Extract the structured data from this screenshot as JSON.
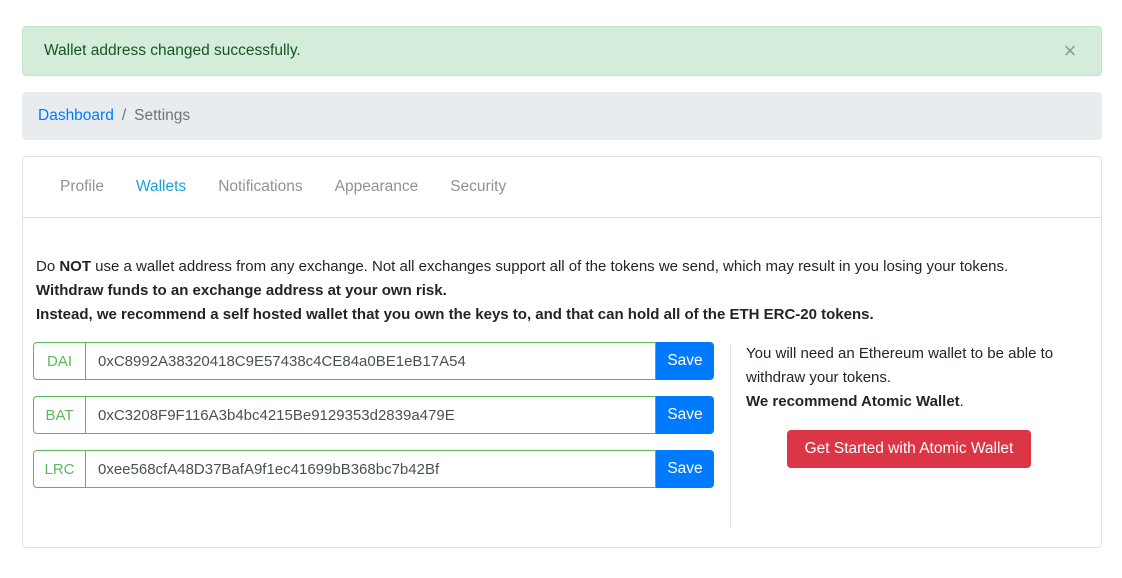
{
  "alert": {
    "message": "Wallet address changed successfully.",
    "close_symbol": "×"
  },
  "breadcrumb": {
    "home": "Dashboard",
    "separator": "/",
    "current": "Settings"
  },
  "tabs": [
    {
      "label": "Profile",
      "active": false
    },
    {
      "label": "Wallets",
      "active": true
    },
    {
      "label": "Notifications",
      "active": false
    },
    {
      "label": "Appearance",
      "active": false
    },
    {
      "label": "Security",
      "active": false
    }
  ],
  "warning": {
    "line1_pre": "Do ",
    "line1_bold": "NOT",
    "line1_post": " use a wallet address from any exchange. Not all exchanges support all of the tokens we send, which may result in you losing your tokens.",
    "line2": "Withdraw funds to an exchange address at your own risk.",
    "line3": "Instead, we recommend a self hosted wallet that you own the keys to, and that can hold all of the ETH ERC-20 tokens."
  },
  "wallets": [
    {
      "token": "DAI",
      "address": "0xC8992A38320418C9E57438c4CE84a0BE1eB17A54",
      "save_label": "Save"
    },
    {
      "token": "BAT",
      "address": "0xC3208F9F116A3b4bc4215Be9129353d2839a479E",
      "save_label": "Save"
    },
    {
      "token": "LRC",
      "address": "0xee568cfA48D37BafA9f1ec41699bB368bc7b42Bf",
      "save_label": "Save"
    }
  ],
  "side": {
    "text": "You will need an Ethereum wallet to be able to withdraw your tokens.",
    "recommend_bold": "We recommend Atomic Wallet",
    "recommend_end": ".",
    "cta_label": "Get Started with Atomic Wallet"
  },
  "colors": {
    "success_bg": "#d4edda",
    "primary": "#007bff",
    "danger": "#dc3545",
    "input_border": "#5cb85c",
    "tab_active": "#17a2d8"
  }
}
